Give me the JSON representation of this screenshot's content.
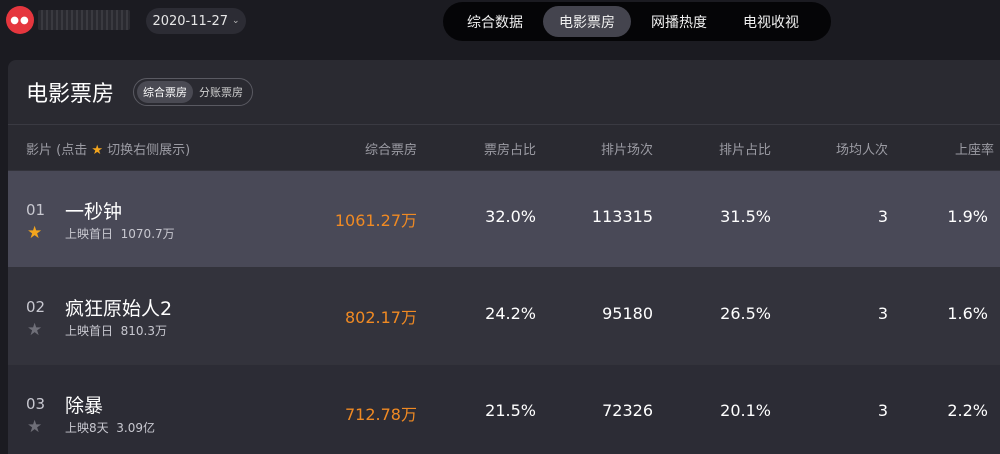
{
  "header": {
    "date": "2020-11-27",
    "nav_tabs": [
      "综合数据",
      "电影票房",
      "网播热度",
      "电视收视"
    ],
    "active_tab": 1
  },
  "panel": {
    "title": "电影票房",
    "segments": [
      "综合票房",
      "分账票房"
    ],
    "active_segment": 0
  },
  "table": {
    "col_film_prefix": "影片 (点击",
    "col_film_suffix": "切换右侧展示)",
    "col_box": "综合票房",
    "col_box_share": "票房占比",
    "col_screenings": "排片场次",
    "col_screen_share": "排片占比",
    "col_avg_attendance": "场均人次",
    "col_occupancy": "上座率",
    "rows": [
      {
        "rank": "01",
        "name": "一秒钟",
        "release": "上映首日",
        "total": "1070.7万",
        "box": "1061.27万",
        "box_share": "32.0%",
        "screenings": "113315",
        "screen_share": "31.5%",
        "avg": "3",
        "occupancy": "1.9%",
        "starred": true
      },
      {
        "rank": "02",
        "name": "疯狂原始人2",
        "release": "上映首日",
        "total": "810.3万",
        "box": "802.17万",
        "box_share": "24.2%",
        "screenings": "95180",
        "screen_share": "26.5%",
        "avg": "3",
        "occupancy": "1.6%",
        "starred": false
      },
      {
        "rank": "03",
        "name": "除暴",
        "release": "上映8天",
        "total": "3.09亿",
        "box": "712.78万",
        "box_share": "21.5%",
        "screenings": "72326",
        "screen_share": "20.1%",
        "avg": "3",
        "occupancy": "2.2%",
        "starred": false
      }
    ]
  },
  "colors": {
    "accent_orange": "#f08a23",
    "star_gold": "#f3a51d",
    "star_grey": "#6f6f78"
  }
}
